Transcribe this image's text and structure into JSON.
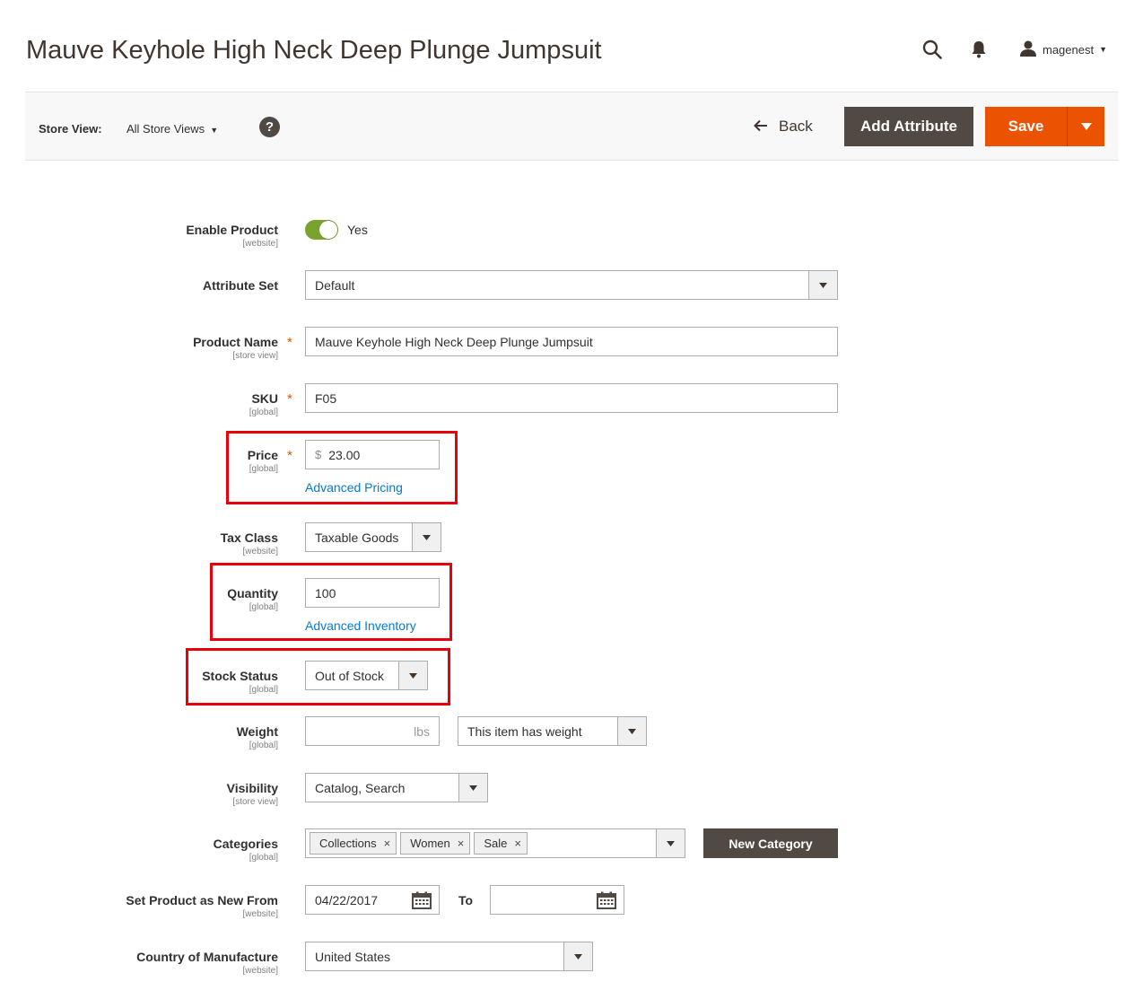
{
  "page": {
    "title": "Mauve Keyhole High Neck Deep Plunge Jumpsuit"
  },
  "header": {
    "username": "magenest",
    "icons": [
      "search-icon",
      "bell-icon",
      "user-icon"
    ]
  },
  "toolbar": {
    "store_view_label": "Store View:",
    "store_view_value": "All Store Views",
    "help_label": "?",
    "back_label": "Back",
    "add_attribute_label": "Add Attribute",
    "save_label": "Save"
  },
  "form": {
    "enable_product": {
      "label": "Enable Product",
      "scope": "[website]",
      "value": "Yes",
      "enabled": true
    },
    "attribute_set": {
      "label": "Attribute Set",
      "value": "Default"
    },
    "product_name": {
      "label": "Product Name",
      "scope": "[store view]",
      "required": "*",
      "value": "Mauve Keyhole High Neck Deep Plunge Jumpsuit"
    },
    "sku": {
      "label": "SKU",
      "scope": "[global]",
      "required": "*",
      "value": "F05"
    },
    "price": {
      "label": "Price",
      "scope": "[global]",
      "required": "*",
      "currency": "$",
      "value": "23.00",
      "link": "Advanced Pricing"
    },
    "tax_class": {
      "label": "Tax Class",
      "scope": "[website]",
      "value": "Taxable Goods"
    },
    "quantity": {
      "label": "Quantity",
      "scope": "[global]",
      "value": "100",
      "link": "Advanced Inventory"
    },
    "stock_status": {
      "label": "Stock Status",
      "scope": "[global]",
      "value": "Out of Stock"
    },
    "weight": {
      "label": "Weight",
      "scope": "[global]",
      "unit": "lbs",
      "value": "",
      "type_value": "This item has weight"
    },
    "visibility": {
      "label": "Visibility",
      "scope": "[store view]",
      "value": "Catalog, Search"
    },
    "categories": {
      "label": "Categories",
      "scope": "[global]",
      "chips": [
        "Collections",
        "Women",
        "Sale"
      ],
      "new_label": "New Category"
    },
    "new_from": {
      "label": "Set Product as New From",
      "scope": "[website]",
      "from_value": "04/22/2017",
      "to_label": "To",
      "to_value": ""
    },
    "country": {
      "label": "Country of Manufacture",
      "scope": "[website]",
      "value": "United States"
    }
  },
  "colors": {
    "accent_orange": "#eb5202",
    "dark_button": "#514943",
    "toggle_on": "#79a22e",
    "link_blue": "#007bdb",
    "highlight_red": "#e8000b"
  }
}
